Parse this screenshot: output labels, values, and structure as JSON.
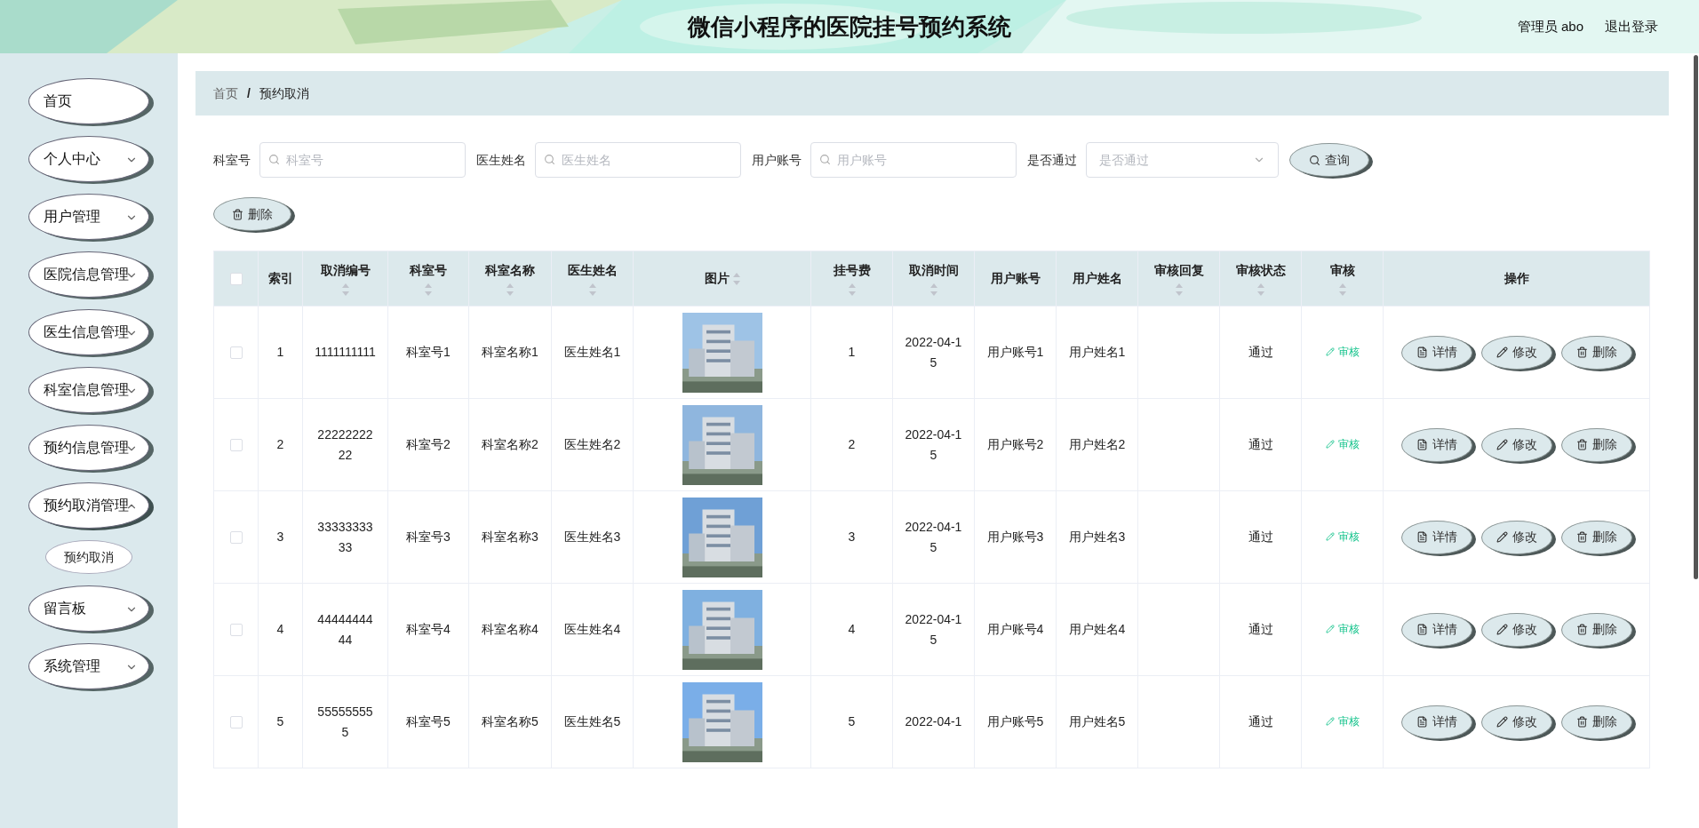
{
  "header": {
    "title": "微信小程序的医院挂号预约系统",
    "user": "管理员 abo",
    "logout": "退出登录"
  },
  "sidebar": {
    "items": [
      {
        "label": "首页",
        "expandable": false,
        "expanded": false
      },
      {
        "label": "个人中心",
        "expandable": true,
        "expanded": false
      },
      {
        "label": "用户管理",
        "expandable": true,
        "expanded": false
      },
      {
        "label": "医院信息管理",
        "expandable": true,
        "expanded": false
      },
      {
        "label": "医生信息管理",
        "expandable": true,
        "expanded": false
      },
      {
        "label": "科室信息管理",
        "expandable": true,
        "expanded": false
      },
      {
        "label": "预约信息管理",
        "expandable": true,
        "expanded": false
      },
      {
        "label": "预约取消管理",
        "expandable": true,
        "expanded": true,
        "children": [
          {
            "label": "预约取消"
          }
        ]
      },
      {
        "label": "留言板",
        "expandable": true,
        "expanded": false
      },
      {
        "label": "系统管理",
        "expandable": true,
        "expanded": false
      }
    ]
  },
  "breadcrumb": [
    "首页",
    "预约取消"
  ],
  "breadcrumb_separator": "/",
  "filters": [
    {
      "kind": "text",
      "label": "科室号",
      "placeholder": "科室号"
    },
    {
      "kind": "text",
      "label": "医生姓名",
      "placeholder": "医生姓名"
    },
    {
      "kind": "text",
      "label": "用户账号",
      "placeholder": "用户账号"
    },
    {
      "kind": "select",
      "label": "是否通过",
      "placeholder": "是否通过"
    }
  ],
  "search_button": "查询",
  "delete_button": "删除",
  "table": {
    "all_checked": false,
    "columns": [
      {
        "label": "索引",
        "sortable": false
      },
      {
        "label": "取消编号",
        "sortable": true
      },
      {
        "label": "科室号",
        "sortable": true
      },
      {
        "label": "科室名称",
        "sortable": true
      },
      {
        "label": "医生姓名",
        "sortable": true
      },
      {
        "label": "图片",
        "sortable": true
      },
      {
        "label": "挂号费",
        "sortable": true
      },
      {
        "label": "取消时间",
        "sortable": true
      },
      {
        "label": "用户账号",
        "sortable": false
      },
      {
        "label": "用户姓名",
        "sortable": false
      },
      {
        "label": "审核回复",
        "sortable": true
      },
      {
        "label": "审核状态",
        "sortable": true
      },
      {
        "label": "审核",
        "sortable": true
      },
      {
        "label": "操作",
        "sortable": false
      }
    ],
    "rows": [
      {
        "checked": false,
        "cells": [
          "1",
          "1111111111",
          "科室号1",
          "科室名称1",
          "医生姓名1",
          null,
          "1",
          "2022-04-15",
          "用户账号1",
          "用户姓名1",
          "",
          "通过"
        ],
        "audit": "审核",
        "actions": [
          "详情",
          "修改",
          "删除"
        ]
      },
      {
        "checked": false,
        "cells": [
          "2",
          "2222222222",
          "科室号2",
          "科室名称2",
          "医生姓名2",
          null,
          "2",
          "2022-04-15",
          "用户账号2",
          "用户姓名2",
          "",
          "通过"
        ],
        "audit": "审核",
        "actions": [
          "详情",
          "修改",
          "删除"
        ]
      },
      {
        "checked": false,
        "cells": [
          "3",
          "3333333333",
          "科室号3",
          "科室名称3",
          "医生姓名3",
          null,
          "3",
          "2022-04-15",
          "用户账号3",
          "用户姓名3",
          "",
          "通过"
        ],
        "audit": "审核",
        "actions": [
          "详情",
          "修改",
          "删除"
        ]
      },
      {
        "checked": false,
        "cells": [
          "4",
          "4444444444",
          "科室号4",
          "科室名称4",
          "医生姓名4",
          null,
          "4",
          "2022-04-15",
          "用户账号4",
          "用户姓名4",
          "",
          "通过"
        ],
        "audit": "审核",
        "actions": [
          "详情",
          "修改",
          "删除"
        ]
      },
      {
        "checked": false,
        "cells": [
          "5",
          "555555555",
          "科室号5",
          "科室名称5",
          "医生姓名5",
          null,
          "5",
          "2022-04-1",
          "用户账号5",
          "用户姓名5",
          "",
          "通过"
        ],
        "audit": "审核",
        "actions": [
          "详情",
          "修改",
          "删除"
        ]
      }
    ]
  }
}
